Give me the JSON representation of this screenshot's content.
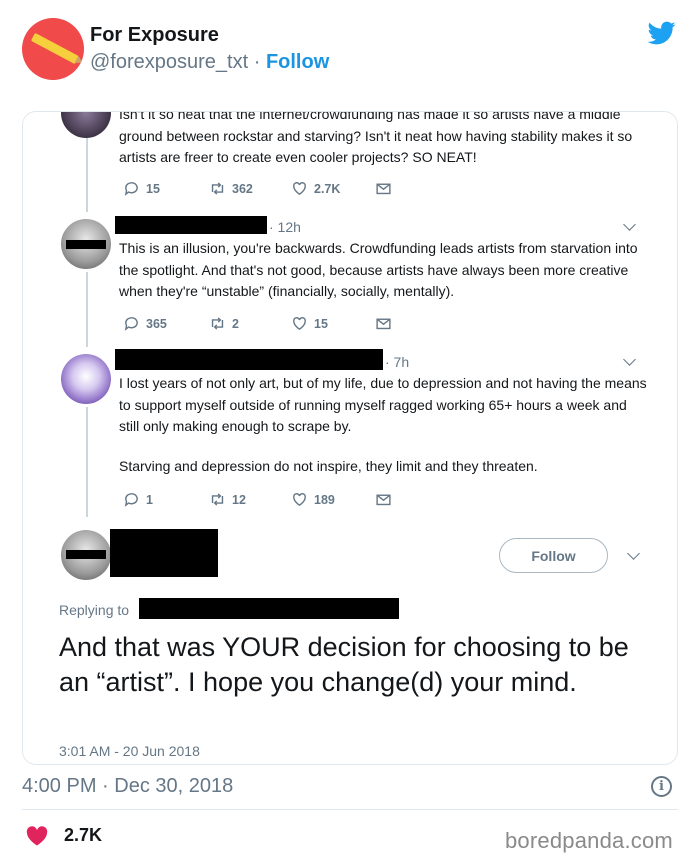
{
  "author": {
    "display_name": "For Exposure",
    "handle": "@forexposure_txt",
    "separator": " · ",
    "follow_label": "Follow"
  },
  "thread": [
    {
      "text": "Isn't it so neat that the internet/crowdfunding has made it so artists have a middle ground between rockstar and starving? Isn't it neat how having stability makes it so artists are freer to create even cooler projects? SO NEAT!",
      "timestamp": "",
      "replies": "15",
      "retweets": "362",
      "likes": "2.7K"
    },
    {
      "text": "This is an illusion, you're backwards. Crowdfunding leads artists from starvation into the spotlight. And that's not good, because artists have always been more creative when they're “unstable” (financially, socially, mentally).",
      "timestamp": "· 12h",
      "replies": "365",
      "retweets": "2",
      "likes": "15"
    },
    {
      "text": "I lost years of not only art, but of my life, due to depression and not having the means to support myself outside of running myself ragged working 65+ hours a week and still only making enough to scrape by.",
      "text2": "Starving and depression do not inspire, they limit and they threaten.",
      "timestamp": "· 7h",
      "replies": "1",
      "retweets": "12",
      "likes": "189"
    }
  ],
  "final_reply": {
    "follow_label": "Follow",
    "replying_to": "Replying to",
    "text": "And that was YOUR decision for choosing to be an “artist”. I hope you change(d) your mind.",
    "timestamp": "3:01 AM - 20 Jun 2018"
  },
  "footer": {
    "post_time": "4:00 PM · Dec 30, 2018",
    "likes": "2.7K",
    "watermark": "boredpanda.com"
  },
  "colors": {
    "twitter_blue": "#1da1f2",
    "link_blue": "#1b95e0",
    "like_red": "#e0245e",
    "muted_gray": "#657786"
  },
  "icons": [
    "pencil-avatar-icon",
    "twitter-bird-icon",
    "reply-icon",
    "retweet-icon",
    "like-icon",
    "message-icon",
    "chevron-down-icon",
    "info-icon",
    "heart-icon"
  ]
}
